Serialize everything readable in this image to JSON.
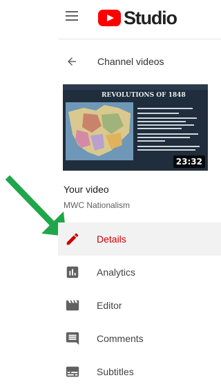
{
  "header": {
    "logo_text": "Studio",
    "menu_icon": "hamburger-menu-icon",
    "logo_icon": "youtube-play-icon"
  },
  "back": {
    "label": "Channel videos",
    "icon": "arrow-left-icon"
  },
  "video": {
    "section_label": "Your video",
    "title": "MWC Nationalism",
    "duration": "23:32",
    "thumbnail_heading": "REVOLUTIONS OF 1848"
  },
  "nav": {
    "items": [
      {
        "label": "Details",
        "icon": "pencil-icon",
        "active": true
      },
      {
        "label": "Analytics",
        "icon": "bar-chart-icon",
        "active": false
      },
      {
        "label": "Editor",
        "icon": "clapperboard-icon",
        "active": false
      },
      {
        "label": "Comments",
        "icon": "comment-icon",
        "active": false
      },
      {
        "label": "Subtitles",
        "icon": "subtitles-icon",
        "active": false
      }
    ]
  },
  "colors": {
    "accent_red": "#cc0000",
    "youtube_red": "#ff0000",
    "annotation_green": "#1fa64a",
    "active_bg": "#f2f2f2"
  }
}
